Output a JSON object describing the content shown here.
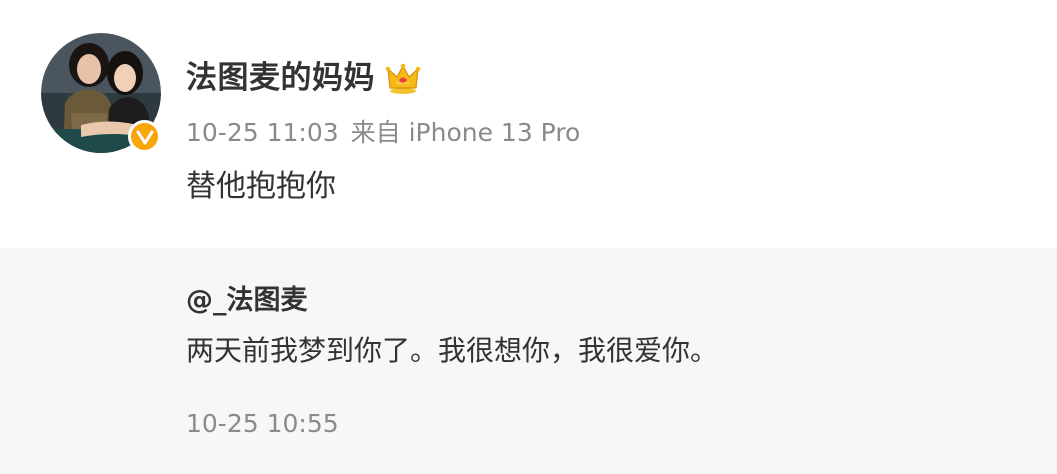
{
  "post": {
    "username": "法图麦的妈妈",
    "time": "10-25 11:03",
    "source": "来自 iPhone 13 Pro",
    "text": "替他抱抱你",
    "badge": "V"
  },
  "reply": {
    "user": "@_法图麦",
    "text": "两天前我梦到你了。我很想你，我很爱你。",
    "time": "10-25 10:55"
  },
  "colors": {
    "badge": "#f7a70a",
    "text": "#333333",
    "muted": "#8a8a8a",
    "reply_bg": "#f7f7f7",
    "crown": "#f5b400"
  },
  "icons": {
    "crown": "crown-icon",
    "verified": "verified-check-icon"
  }
}
